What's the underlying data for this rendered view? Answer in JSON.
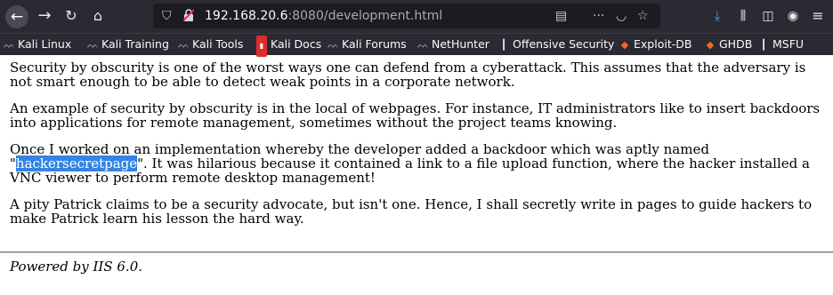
{
  "browser": {
    "url_host": "192.168.20.6",
    "url_rest": ":8080/development.html",
    "bookmarks": [
      {
        "label": "Kali Linux",
        "icon": "kali-dragon-icon"
      },
      {
        "label": "Kali Training",
        "icon": "kali-dragon-icon"
      },
      {
        "label": "Kali Tools",
        "icon": "kali-dragon-icon"
      },
      {
        "label": "Kali Docs",
        "icon": "kali-docs-icon"
      },
      {
        "label": "Kali Forums",
        "icon": "kali-dragon-icon"
      },
      {
        "label": "NetHunter",
        "icon": "nethunter-icon"
      },
      {
        "label": "Offensive Security",
        "icon": "offsec-icon"
      },
      {
        "label": "Exploit-DB",
        "icon": "exploitdb-icon"
      },
      {
        "label": "GHDB",
        "icon": "ghdb-icon"
      },
      {
        "label": "MSFU",
        "icon": "offsec-icon"
      }
    ]
  },
  "page": {
    "p1": "Security by obscurity is one of the worst ways one can defend from a cyberattack. This assumes that the adversary is not smart enough to be able to detect weak points in a corporate network.",
    "p2": "An example of security by obscurity is in the local of webpages. For instance, IT administrators like to insert backdoors into applications for remote management, sometimes without the project teams knowing.",
    "p3_before": "Once I worked on an implementation whereby the developer added a backdoor which was aptly named \"",
    "p3_highlight": "hackersecretpage",
    "p3_after": "\". It was hilarious because it contained a link to a file upload function, where the hacker installed a VNC viewer to perform remote desktop management!",
    "p4": "A pity Patrick claims to be a security advocate, but isn't one. Hence, I shall secretly write in pages to guide hackers to make Patrick learn his lesson the hard way.",
    "footer": "Powered by IIS 6.0."
  },
  "colors": {
    "toolbar": "#2b2a33",
    "urlbar": "#1c1b22",
    "highlight": "#3584e4",
    "download_icon": "#4a9ff5"
  }
}
